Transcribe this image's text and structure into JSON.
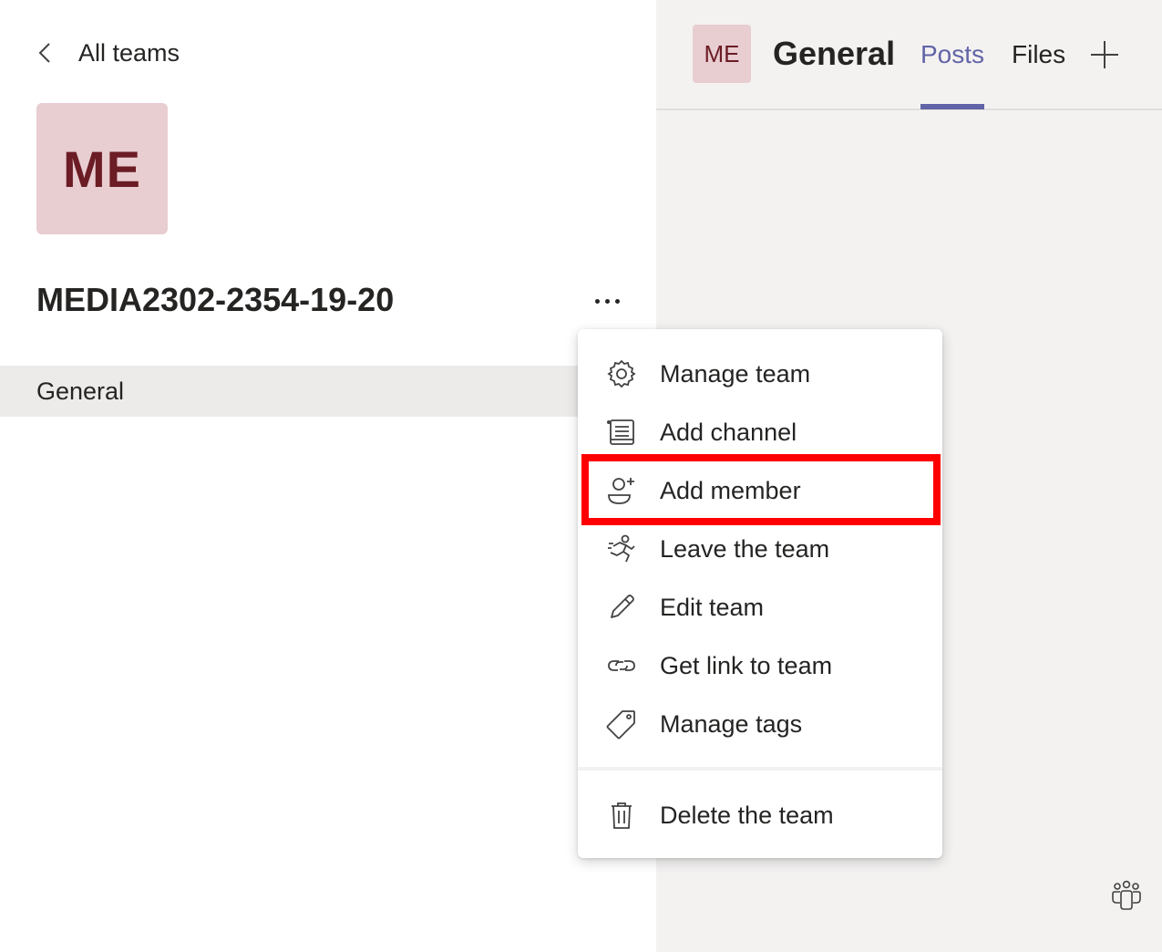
{
  "left_panel": {
    "back_label": "All teams",
    "team_avatar_initials": "ME",
    "team_name": "MEDIA2302-2354-19-20",
    "channels": [
      {
        "label": "General"
      }
    ]
  },
  "right_panel": {
    "channel_avatar_initials": "ME",
    "channel_title": "General",
    "tabs": [
      {
        "label": "Posts",
        "active": true
      },
      {
        "label": "Files",
        "active": false
      }
    ]
  },
  "menu": {
    "items": [
      {
        "label": "Manage team",
        "icon": "gear-icon"
      },
      {
        "label": "Add channel",
        "icon": "channel-list-icon"
      },
      {
        "label": "Add member",
        "icon": "add-person-icon",
        "highlighted": true
      },
      {
        "label": "Leave the team",
        "icon": "running-person-icon"
      },
      {
        "label": "Edit team",
        "icon": "pencil-icon"
      },
      {
        "label": "Get link to team",
        "icon": "link-icon"
      },
      {
        "label": "Manage tags",
        "icon": "tag-icon"
      },
      {
        "label": "Delete the team",
        "icon": "trash-icon"
      }
    ]
  },
  "colors": {
    "accent": "#6264a7",
    "avatar_bg": "#e8cdd1",
    "avatar_text": "#6b1c24",
    "highlight": "#ff0000"
  }
}
